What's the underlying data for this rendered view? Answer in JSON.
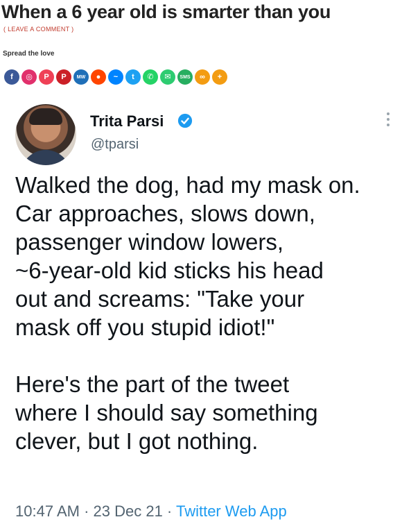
{
  "article": {
    "title": "When a 6 year old is smarter than you",
    "leave_comment": "( LEAVE A COMMENT )",
    "spread": "Spread the love"
  },
  "share_buttons": [
    {
      "name": "facebook",
      "icon": "facebook-icon",
      "color": "#3b5998",
      "glyph": "f"
    },
    {
      "name": "instagram",
      "icon": "instagram-icon",
      "color": "#e1306c",
      "glyph": "◎"
    },
    {
      "name": "pocket",
      "icon": "pocket-icon",
      "color": "#ef4056",
      "glyph": "P"
    },
    {
      "name": "pinterest",
      "icon": "pinterest-icon",
      "color": "#cb2027",
      "glyph": "P"
    },
    {
      "name": "mewe",
      "icon": "mewe-icon",
      "color": "#1f6fb8",
      "glyph": "MW"
    },
    {
      "name": "reddit",
      "icon": "reddit-icon",
      "color": "#ff4500",
      "glyph": "●"
    },
    {
      "name": "messenger",
      "icon": "messenger-icon",
      "color": "#0084ff",
      "glyph": "~"
    },
    {
      "name": "twitter",
      "icon": "twitter-icon",
      "color": "#1da1f2",
      "glyph": "t"
    },
    {
      "name": "whatsapp",
      "icon": "whatsapp-icon",
      "color": "#25d366",
      "glyph": "✆"
    },
    {
      "name": "email",
      "icon": "email-icon",
      "color": "#2ecc71",
      "glyph": "✉"
    },
    {
      "name": "sms",
      "icon": "sms-icon",
      "color": "#27ae60",
      "glyph": "SMS"
    },
    {
      "name": "copy-link",
      "icon": "link-icon",
      "color": "#f39c12",
      "glyph": "∞"
    },
    {
      "name": "more",
      "icon": "plus-icon",
      "color": "#f39c12",
      "glyph": "+"
    }
  ],
  "tweet": {
    "author_name": "Trita Parsi",
    "handle": "@tparsi",
    "body_lines": [
      "Walked the dog, had my mask on.",
      "Car approaches, slows down,",
      "passenger window lowers,",
      "~6-year-old kid sticks his head",
      "out and screams: \"Take your",
      "mask off you stupid idiot!\""
    ],
    "body_lines_2": [
      "Here's the part of the tweet",
      "where I should say something",
      "clever, but I got nothing."
    ],
    "time": "10:47 AM",
    "date": "23 Dec 21",
    "app": "Twitter Web App",
    "separator": " · ",
    "colors": {
      "verified": "#1d9bf0",
      "link": "#1d9bf0",
      "muted": "#536471"
    }
  }
}
